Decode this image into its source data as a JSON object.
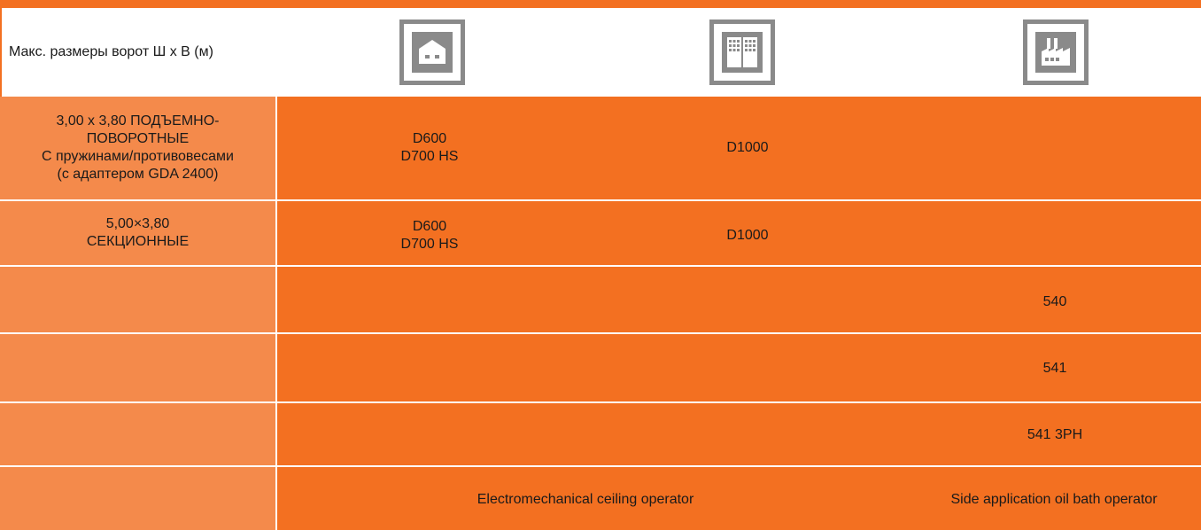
{
  "header": {
    "label": "Макс. размеры ворот Ш x В (м)",
    "icons": [
      "house-icon",
      "apartment-building-icon",
      "factory-icon"
    ]
  },
  "rows": [
    {
      "left": "3,00 x 3,80 ПОДЪЕМНО-\nПОВОРОТНЫЕ\nС пружинами/противовесами\n(с адаптером GDA 2400)",
      "col1": "D600\nD700 HS",
      "col2": "D1000",
      "col3": ""
    },
    {
      "left": "5,00×3,80\nСЕКЦИОННЫЕ",
      "col1": "D600\nD700 HS",
      "col2": "D1000",
      "col3": ""
    },
    {
      "left": "",
      "col1": "",
      "col2": "",
      "col3": "540"
    },
    {
      "left": "",
      "col1": "",
      "col2": "",
      "col3": "541"
    },
    {
      "left": "",
      "col1": "",
      "col2": "",
      "col3": "541 3PH"
    },
    {
      "left": "",
      "col1": "",
      "col2": "Electromechanical ceiling operator",
      "col3": "Side application oil bath operator"
    }
  ],
  "colors": {
    "accent": "#f37021",
    "light_accent": "#f48a4b",
    "icon_gray": "#8a8a8a"
  }
}
